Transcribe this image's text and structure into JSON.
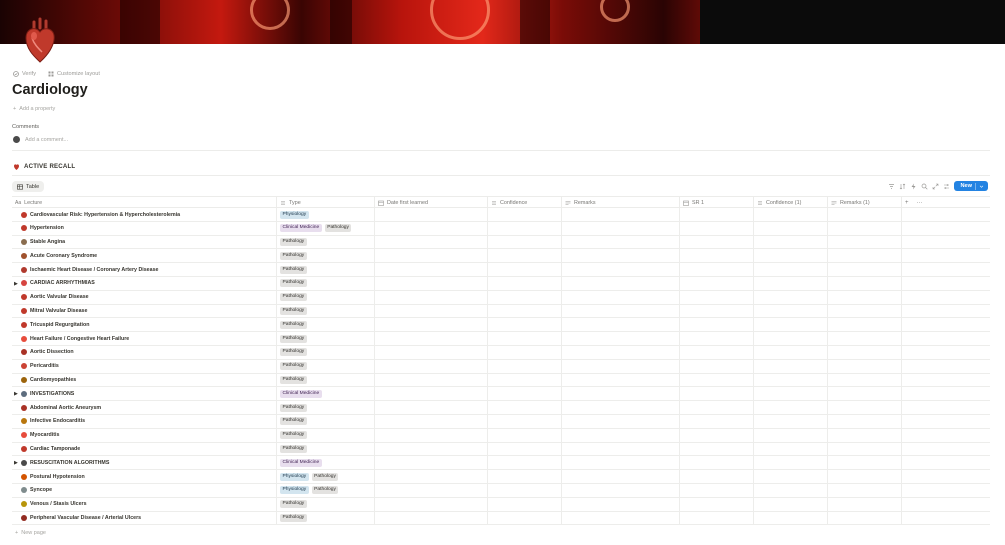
{
  "header": {
    "verify_label": "Verify",
    "customize_label": "Customize layout",
    "title": "Cardiology",
    "add_property": "Add a property",
    "comments_label": "Comments",
    "comment_placeholder": "Add a comment..."
  },
  "section": {
    "title": "ACTIVE RECALL"
  },
  "view": {
    "tab_label": "Table",
    "new_label": "New"
  },
  "columns": [
    "Lecture",
    "Type",
    "Date first learned",
    "Confidence",
    "Remarks",
    "SR 1",
    "Confidence (1)",
    "Remarks (1)"
  ],
  "colors": {
    "accent": "#2383e2",
    "physiology": "#d3e5ef",
    "pathology": "#e3e2e0",
    "clinical": "#e8deee"
  },
  "rows": [
    {
      "name": "Cardiovascular Risk: Hypertension & Hypercholesterolemia",
      "toggle": false,
      "icon": "heart-icon",
      "icon_color": "#c0392b",
      "tags": [
        "Physiology"
      ]
    },
    {
      "name": "Hypertension",
      "toggle": false,
      "icon": "heart-icon",
      "icon_color": "#c0392b",
      "tags": [
        "Clinical Medicine",
        "Pathology"
      ]
    },
    {
      "name": "Stable Angina",
      "toggle": false,
      "icon": "person-icon",
      "icon_color": "#8a6d4f",
      "tags": [
        "Pathology"
      ]
    },
    {
      "name": "Acute Coronary Syndrome",
      "toggle": false,
      "icon": "person-icon",
      "icon_color": "#a0522d",
      "tags": [
        "Pathology"
      ]
    },
    {
      "name": "Ischaemic Heart Disease / Coronary Artery Disease",
      "toggle": false,
      "icon": "heart-icon",
      "icon_color": "#b03a2e",
      "tags": [
        "Pathology"
      ]
    },
    {
      "name": "CARDIAC ARRHYTHMIAS",
      "toggle": true,
      "icon": "heart-icon",
      "icon_color": "#d64541",
      "tags": [
        "Pathology"
      ]
    },
    {
      "name": "Aortic Valvular Disease",
      "toggle": false,
      "icon": "valve-icon",
      "icon_color": "#c0392b",
      "tags": [
        "Pathology"
      ]
    },
    {
      "name": "Mitral Valvular Disease",
      "toggle": false,
      "icon": "valve-icon",
      "icon_color": "#c0392b",
      "tags": [
        "Pathology"
      ]
    },
    {
      "name": "Tricuspid Regurgitation",
      "toggle": false,
      "icon": "valve-icon",
      "icon_color": "#c0392b",
      "tags": [
        "Pathology"
      ]
    },
    {
      "name": "Heart Failure / Congestive Heart Failure",
      "toggle": false,
      "icon": "heart-icon",
      "icon_color": "#e74c3c",
      "tags": [
        "Pathology"
      ]
    },
    {
      "name": "Aortic Dissection",
      "toggle": false,
      "icon": "vessel-icon",
      "icon_color": "#a93226",
      "tags": [
        "Pathology"
      ]
    },
    {
      "name": "Pericarditis",
      "toggle": false,
      "icon": "heart-icon",
      "icon_color": "#cb4335",
      "tags": [
        "Pathology"
      ]
    },
    {
      "name": "Cardiomyopathies",
      "toggle": false,
      "icon": "heart-icon",
      "icon_color": "#9c640c",
      "tags": [
        "Pathology"
      ]
    },
    {
      "name": "INVESTIGATIONS",
      "toggle": true,
      "icon": "clipboard-icon",
      "icon_color": "#5d6d7e",
      "tags": [
        "Clinical Medicine"
      ]
    },
    {
      "name": "Abdominal Aortic Aneurysm",
      "toggle": false,
      "icon": "vessel-icon",
      "icon_color": "#a93226",
      "tags": [
        "Pathology"
      ]
    },
    {
      "name": "Infective Endocarditis",
      "toggle": false,
      "icon": "heart-icon",
      "icon_color": "#b9770e",
      "tags": [
        "Pathology"
      ]
    },
    {
      "name": "Myocarditis",
      "toggle": false,
      "icon": "heart-icon",
      "icon_color": "#e74c3c",
      "tags": [
        "Pathology"
      ]
    },
    {
      "name": "Cardiac Tamponade",
      "toggle": false,
      "icon": "heart-icon",
      "icon_color": "#c0392b",
      "tags": [
        "Pathology"
      ]
    },
    {
      "name": "RESUSCITATION ALGORITHMS",
      "toggle": true,
      "icon": "person-icon",
      "icon_color": "#4a4a4a",
      "tags": [
        "Clinical Medicine"
      ]
    },
    {
      "name": "Postural Hypotension",
      "toggle": false,
      "icon": "heart-icon",
      "icon_color": "#d35400",
      "tags": [
        "Physiology",
        "Pathology"
      ]
    },
    {
      "name": "Syncope",
      "toggle": false,
      "icon": "person-icon",
      "icon_color": "#7f8c8d",
      "tags": [
        "Physiology",
        "Pathology"
      ]
    },
    {
      "name": "Venous / Stasis Ulcers",
      "toggle": false,
      "icon": "leg-icon",
      "icon_color": "#b7950b",
      "tags": [
        "Pathology"
      ]
    },
    {
      "name": "Peripheral Vascular Disease / Arterial Ulcers",
      "toggle": false,
      "icon": "heart-icon",
      "icon_color": "#922b21",
      "tags": [
        "Pathology"
      ]
    }
  ],
  "footer": {
    "new_page": "New page"
  }
}
